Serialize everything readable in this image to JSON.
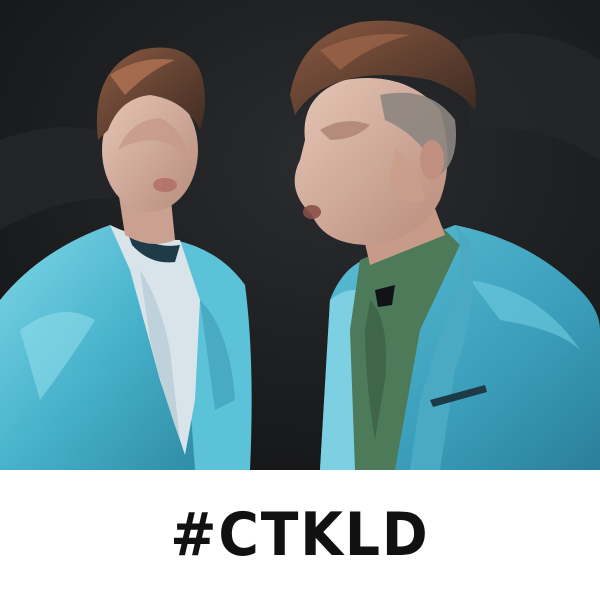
{
  "caption": {
    "hashtag": "#CTKLD"
  },
  "artwork": {
    "style": "watercolor-painted photo",
    "subjects": [
      "performer-left",
      "performer-right"
    ],
    "colors": {
      "background": "#1c1d1f",
      "jacket": "#4fb6cc",
      "shirt-right": "#4d7a58",
      "hair": "#6b4333",
      "skin": "#d9b5a4"
    }
  }
}
